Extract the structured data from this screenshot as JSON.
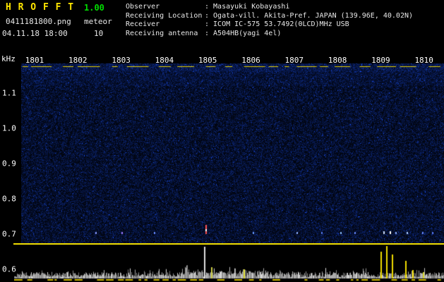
{
  "header": {
    "app_title": "H R O F F T",
    "version": "1.00",
    "filename": "0411181800.png",
    "mode_label": "meteor",
    "meteor_count": "10",
    "datetime": "04.11.18 18:00",
    "info": [
      {
        "label": "Observer",
        "value": ": Masayuki Kobayashi"
      },
      {
        "label": "Receiving Location",
        "value": ": Ogata-vill. Akita-Pref. JAPAN (139.96E, 40.02N)"
      },
      {
        "label": "Receiver",
        "value": ": ICOM IC-575 53.7492(0LCD)MHz USB"
      },
      {
        "label": "Receiving antenna",
        "value": ": A504HB(yagi 4el)"
      }
    ]
  },
  "colors": {
    "background": "#000000",
    "title_yellow": "#ffe600",
    "version_green": "#00dd00",
    "text_white": "#e8e8e8",
    "marker_yellow": "#f0dc00",
    "noise_blue": "#2030a0",
    "echo_red": "#ff5050"
  },
  "chart_data": {
    "type": "heatmap",
    "title": "HROFFT radio meteor echo spectrogram with signal-level strip",
    "x": {
      "tick_labels": [
        "1801",
        "1802",
        "1803",
        "1804",
        "1805",
        "1806",
        "1807",
        "1808",
        "1809",
        "1810"
      ],
      "range_hhmm": [
        "1800",
        "1810"
      ]
    },
    "y": {
      "unit_label": "kHz",
      "tick_labels": [
        "1.1",
        "1.0",
        "0.9",
        "0.8",
        "0.7",
        "0.6"
      ],
      "tick_values": [
        1.1,
        1.0,
        0.9,
        0.8,
        0.7,
        0.6
      ],
      "top_khz": 1.18,
      "separator_khz": 0.675
    },
    "background_texture": "dense dark-blue random noise speckle, brighter band at top",
    "marker_lines": {
      "top_dashed_color": "#e8d200",
      "separator_solid_color": "#f0dc00",
      "bottom_dashed_color": "#c8b400"
    },
    "echoes": [
      {
        "t": 0.1753,
        "f_khz": 0.7,
        "color": "#8899ff",
        "w": 2,
        "h": 3
      },
      {
        "t": 0.2371,
        "f_khz": 0.7,
        "color": "#9977ff",
        "w": 2,
        "h": 3
      },
      {
        "t": 0.3139,
        "f_khz": 0.7,
        "color": "#6688ff",
        "w": 2,
        "h": 3
      },
      {
        "t": 0.4357,
        "f_khz": 0.7,
        "color": "#ff5050",
        "w": 2,
        "h": 13,
        "core": true
      },
      {
        "t": 0.5476,
        "f_khz": 0.7,
        "color": "#6699ff",
        "w": 2,
        "h": 3
      },
      {
        "t": 0.6511,
        "f_khz": 0.7,
        "color": "#88aaff",
        "w": 2,
        "h": 3
      },
      {
        "t": 0.7095,
        "f_khz": 0.7,
        "color": "#5577ee",
        "w": 2,
        "h": 3
      },
      {
        "t": 0.7546,
        "f_khz": 0.7,
        "color": "#88bbff",
        "w": 2,
        "h": 3
      },
      {
        "t": 0.788,
        "f_khz": 0.7,
        "color": "#6688ff",
        "w": 2,
        "h": 3
      },
      {
        "t": 0.8564,
        "f_khz": 0.7,
        "color": "#cfe0ff",
        "w": 2,
        "h": 4
      },
      {
        "t": 0.8714,
        "f_khz": 0.7,
        "color": "#ffffff",
        "w": 2,
        "h": 4
      },
      {
        "t": 0.8848,
        "f_khz": 0.7,
        "color": "#88aaff",
        "w": 2,
        "h": 3
      },
      {
        "t": 0.9115,
        "f_khz": 0.7,
        "color": "#aaccff",
        "w": 2,
        "h": 3
      },
      {
        "t": 0.9482,
        "f_khz": 0.7,
        "color": "#6688ff",
        "w": 2,
        "h": 3
      },
      {
        "t": 0.9716,
        "f_khz": 0.7,
        "color": "#5577ee",
        "w": 2,
        "h": 3
      }
    ],
    "level_plot": {
      "noise": "random gray baseline noise, denser mid-left",
      "spikes": [
        {
          "t": 0.4341,
          "h": 45,
          "color": "#e0e0e0"
        },
        {
          "t": 0.4508,
          "h": 16,
          "color": "#cccc44"
        },
        {
          "t": 0.5276,
          "h": 13,
          "color": "#d8d830"
        },
        {
          "t": 0.8514,
          "h": 38,
          "color": "#f0dc00"
        },
        {
          "t": 0.8648,
          "h": 46,
          "color": "#f0dc00"
        },
        {
          "t": 0.8781,
          "h": 34,
          "color": "#f0dc00"
        },
        {
          "t": 0.9098,
          "h": 25,
          "color": "#f0dc00"
        },
        {
          "t": 0.9265,
          "h": 12,
          "color": "#f0dc00"
        },
        {
          "t": 0.9516,
          "h": 9,
          "color": "#d8d830"
        }
      ]
    }
  }
}
